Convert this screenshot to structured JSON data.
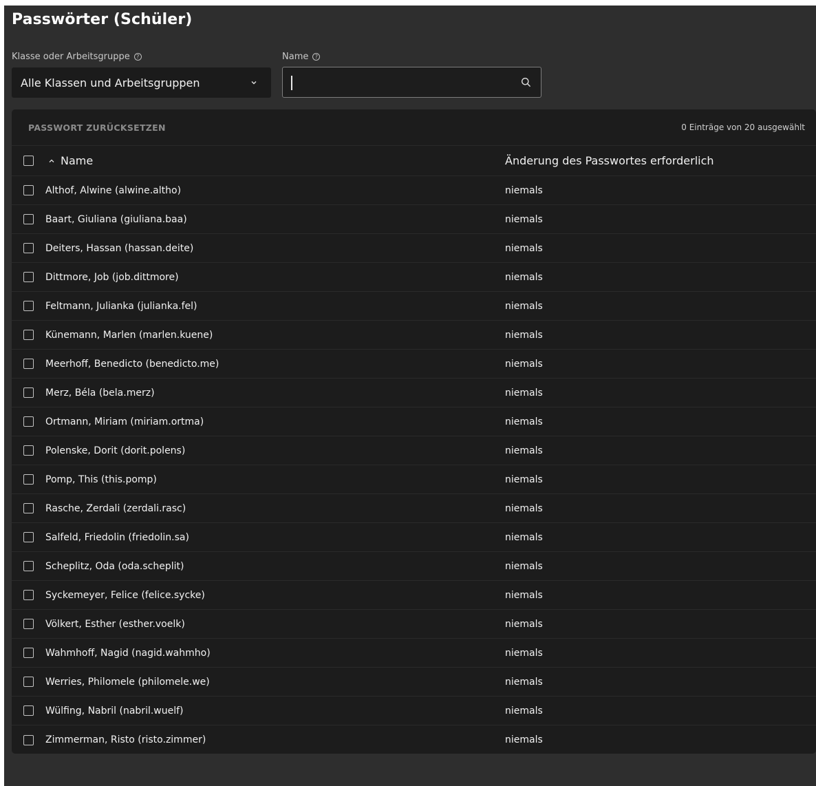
{
  "page": {
    "title": "Passwörter (Schüler)"
  },
  "filters": {
    "class_label": "Klasse oder Arbeitsgruppe",
    "class_value": "Alle Klassen und Arbeitsgruppen",
    "name_label": "Name",
    "name_value": ""
  },
  "toolbar": {
    "reset_label": "PASSWORT ZURÜCKSETZEN",
    "selection_text": "0 Einträge von 20 ausgewählt"
  },
  "table": {
    "columns": {
      "name": "Name",
      "change": "Änderung des Passwortes erforderlich"
    },
    "rows": [
      {
        "name": "Althof, Alwine (alwine.altho)",
        "change": "niemals"
      },
      {
        "name": "Baart, Giuliana (giuliana.baa)",
        "change": "niemals"
      },
      {
        "name": "Deiters, Hassan (hassan.deite)",
        "change": "niemals"
      },
      {
        "name": "Dittmore, Job (job.dittmore)",
        "change": "niemals"
      },
      {
        "name": "Feltmann, Julianka (julianka.fel)",
        "change": "niemals"
      },
      {
        "name": "Künemann, Marlen (marlen.kuene)",
        "change": "niemals"
      },
      {
        "name": "Meerhoff, Benedicto (benedicto.me)",
        "change": "niemals"
      },
      {
        "name": "Merz, Béla (bela.merz)",
        "change": "niemals"
      },
      {
        "name": "Ortmann, Miriam (miriam.ortma)",
        "change": "niemals"
      },
      {
        "name": "Polenske, Dorit (dorit.polens)",
        "change": "niemals"
      },
      {
        "name": "Pomp, This (this.pomp)",
        "change": "niemals"
      },
      {
        "name": "Rasche, Zerdali (zerdali.rasc)",
        "change": "niemals"
      },
      {
        "name": "Salfeld, Friedolin (friedolin.sa)",
        "change": "niemals"
      },
      {
        "name": "Scheplitz, Oda (oda.scheplit)",
        "change": "niemals"
      },
      {
        "name": "Syckemeyer, Felice (felice.sycke)",
        "change": "niemals"
      },
      {
        "name": "Völkert, Esther (esther.voelk)",
        "change": "niemals"
      },
      {
        "name": "Wahmhoff, Nagid (nagid.wahmho)",
        "change": "niemals"
      },
      {
        "name": "Werries, Philomele (philomele.we)",
        "change": "niemals"
      },
      {
        "name": "Wülfing, Nabril (nabril.wuelf)",
        "change": "niemals"
      },
      {
        "name": "Zimmerman, Risto (risto.zimmer)",
        "change": "niemals"
      }
    ]
  },
  "icons": {
    "help": "help-circle-icon",
    "dropdown": "chevron-down-icon",
    "search": "search-icon",
    "sort": "sort-ascending-icon"
  },
  "colors": {
    "background": "#2e2e2e",
    "panel": "#1c1c1c",
    "text": "#f2f2f2",
    "muted": "#8b8b8b"
  }
}
